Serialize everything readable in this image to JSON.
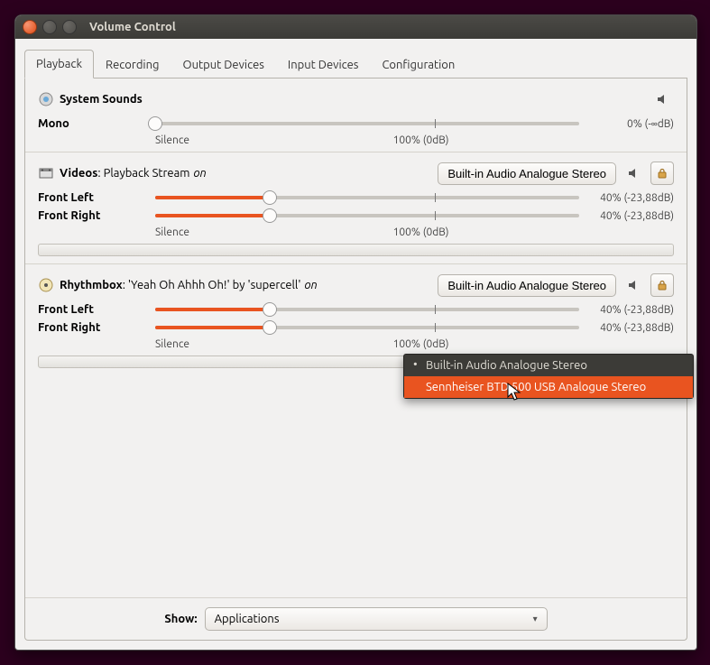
{
  "window": {
    "title": "Volume Control"
  },
  "tabs": {
    "playback": "Playback",
    "recording": "Recording",
    "output": "Output Devices",
    "input": "Input Devices",
    "config": "Configuration"
  },
  "scale": {
    "silence": "Silence",
    "hundred": "100% (0dB)"
  },
  "streams": {
    "system": {
      "name": "System Sounds",
      "mono_label": "Mono",
      "mono_readout": "0% (-∞dB)",
      "mono_pct": 0
    },
    "videos": {
      "name": "Videos",
      "title": ": Playback Stream",
      "on": "on",
      "device": "Built-in Audio Analogue Stereo",
      "fl_label": "Front Left",
      "fr_label": "Front Right",
      "fl_readout": "40% (-23,88dB)",
      "fr_readout": "40% (-23,88dB)",
      "fl_pct": 27,
      "fr_pct": 27
    },
    "rhythmbox": {
      "name": "Rhythmbox",
      "title": ": 'Yeah Oh Ahhh Oh!' by 'supercell'",
      "on": "on",
      "device": "Built-in Audio Analogue Stereo",
      "fl_label": "Front Left",
      "fr_label": "Front Right",
      "fl_readout": "40% (-23,88dB)",
      "fr_readout": "40% (-23,88dB)",
      "fl_pct": 27,
      "fr_pct": 27
    }
  },
  "popup": {
    "opt1": "Built-in Audio Analogue Stereo",
    "opt2": "Sennheiser BTD 500 USB Analogue Stereo"
  },
  "bottom": {
    "show_label": "Show:",
    "show_value": "Applications"
  }
}
